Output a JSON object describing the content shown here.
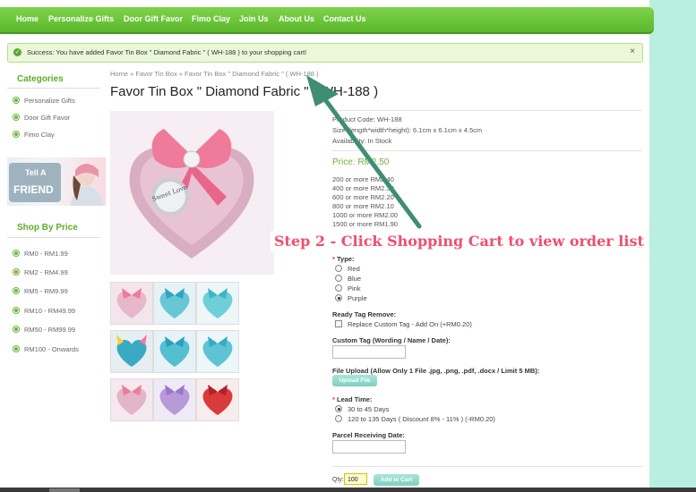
{
  "nav": {
    "items": [
      "Home",
      "Personalize Gifts",
      "Door Gift Favor",
      "Fimo Clay",
      "Join Us",
      "About Us",
      "Contact Us"
    ]
  },
  "alert": {
    "text": "Success: You have added Favor Tin Box \" Diamond Fabric \" ( WH-188 ) to your shopping cart!",
    "icon": "check-circle-icon",
    "close": "×"
  },
  "sidebar": {
    "categories_title": "Categories",
    "categories": [
      "Personalize Gifts",
      "Door Gift Favor",
      "Fimo Clay"
    ],
    "banner": {
      "line1": "Tell A",
      "line2": "FRIEND"
    },
    "price_title": "Shop By Price",
    "prices": [
      "RM0 - RM1.99",
      "RM2 - RM4.99",
      "RM5 - RM9.99",
      "RM10 - RM49.99",
      "RM50 - RM99.99",
      "RM100 - Onwards"
    ]
  },
  "breadcrumb": {
    "items": [
      "Home",
      "Favor Tin Box",
      "Favor Tin Box \" Diamond Fabric \" ( WH-188 )"
    ],
    "separator": "»"
  },
  "product": {
    "title": "Favor Tin Box \" Diamond Fabric \" ( WH-188 )",
    "code": "Product Code: WH-188",
    "size": "Size (length*width*height): 6.1cm x 6.1cm x 4.5cm",
    "availability": "Availability: In Stock",
    "price": "Price: RM2.50",
    "discounts": [
      "200 or more RM2.40",
      "400 or more RM2.30",
      "600 or more RM2.20",
      "800 or more RM2.10",
      "1000 or more RM2.00",
      "1500 or more RM1.90"
    ],
    "img_lid_text": "Sweet Love"
  },
  "options": {
    "required_mark": "*",
    "type_label": "Type:",
    "types": [
      "Red",
      "Blue",
      "Pink",
      "Purple"
    ],
    "type_selected": "Purple",
    "tag_remove_label": "Ready Tag Remove:",
    "tag_remove_option": "Replace Custom Tag - Add On (+RM0.20)",
    "custom_tag_label": "Custom Tag (Wording / Name / Date):",
    "file_upload_label": "File Upload (Allow Only 1 File .jpg, .png, .pdf, .docx / Limit 5 MB):",
    "upload_button": "Upload File",
    "lead_time_label": "Lead Time:",
    "lead_times": [
      "30 to 45 Days",
      "120 to 135 Days ( Discount 8% - 11% ) (-RM0.20)"
    ],
    "lead_time_selected": "30 to 45 Days",
    "parcel_date_label": "Parcel Receiving Date:",
    "qty_label": "Qty:",
    "qty_value": "100",
    "add_to_cart": "Add to Cart"
  },
  "annotation": {
    "text": "Step 2 - Click Shopping Cart to view order list",
    "color": "#ee4f6e",
    "arrow_color": "#3f8e72"
  },
  "colors": {
    "nav_green": "#5cb82c",
    "accent_green": "#6cb33f",
    "button_teal": "#7fd0c1"
  }
}
